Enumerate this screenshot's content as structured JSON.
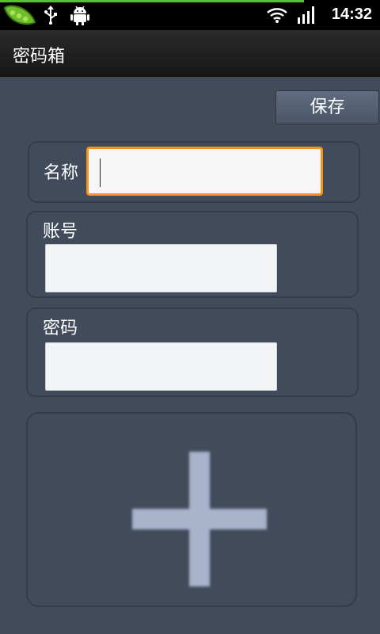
{
  "status_bar": {
    "time": "14:32",
    "icons": [
      "pea-pod-app-icon",
      "usb-icon",
      "android-debug-icon",
      "wifi-icon",
      "signal-icon"
    ]
  },
  "titlebar": {
    "title": "密码箱"
  },
  "toolbar": {
    "save_label": "保存"
  },
  "form": {
    "name_label": "名称",
    "name_value": "",
    "account_label": "账号",
    "account_value": "",
    "password_label": "密码",
    "password_value": ""
  },
  "add_area": {
    "icon": "plus-icon"
  },
  "colors": {
    "background": "#414b5c",
    "focus": "#f0941d",
    "accent_progress": "#57c22f"
  }
}
